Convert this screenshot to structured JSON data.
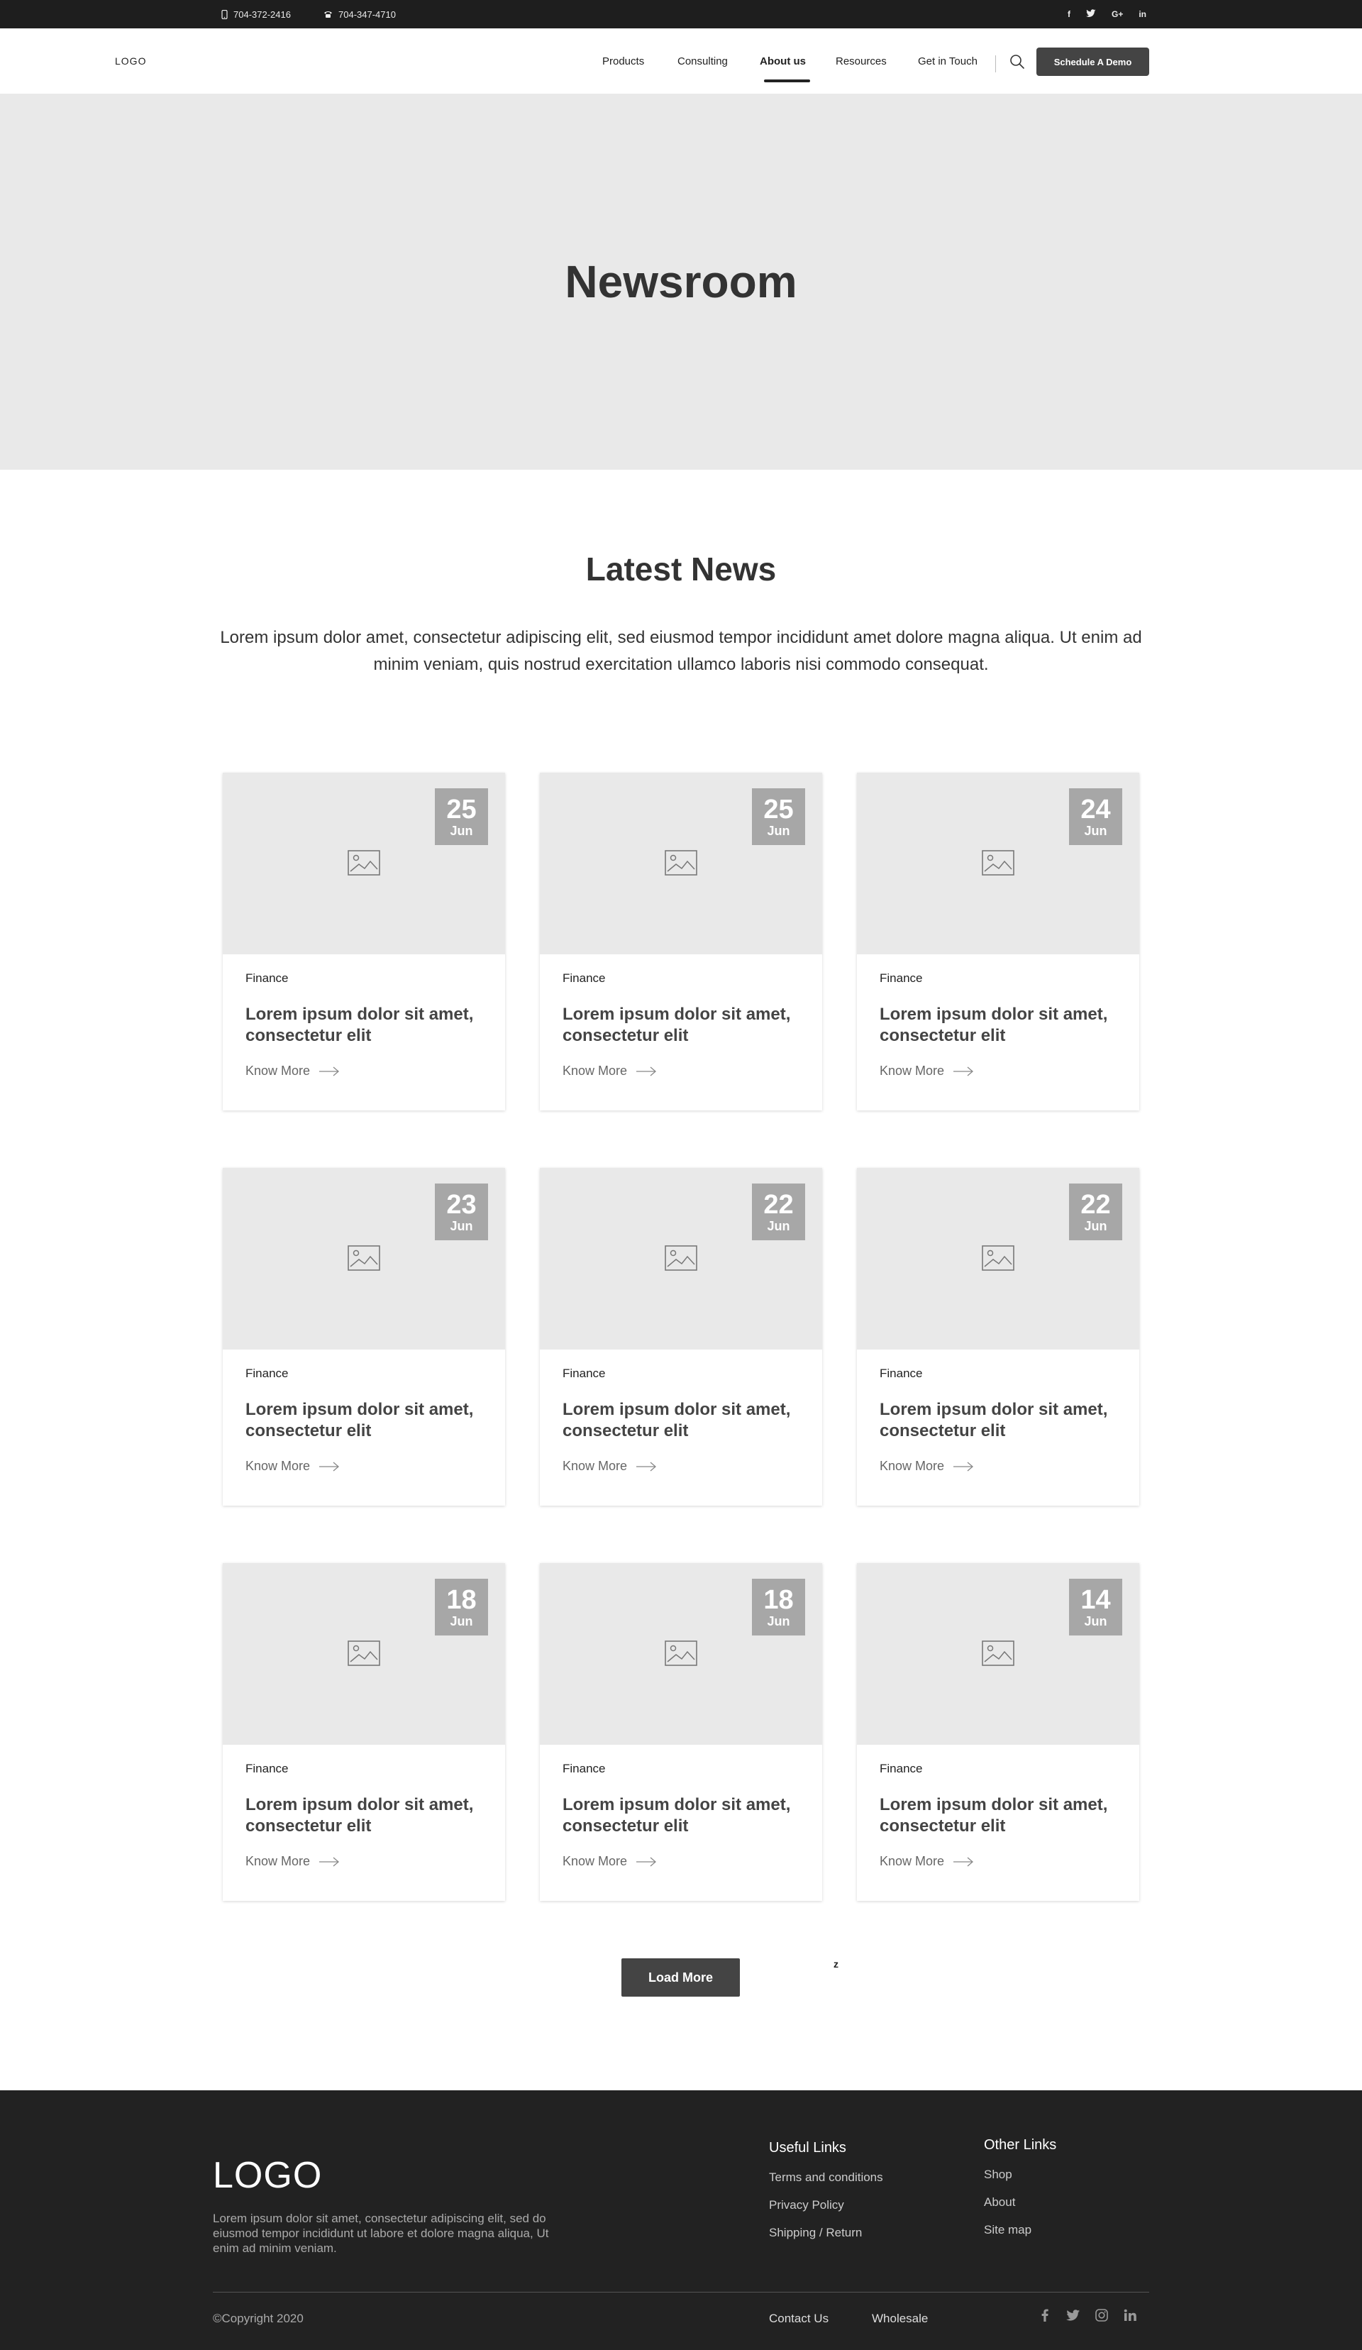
{
  "topbar": {
    "phone1": "704-372-2416",
    "phone2": "704-347-4710",
    "social": [
      "f",
      "t",
      "G+",
      "in"
    ]
  },
  "nav": {
    "logo": "LOGO",
    "items": [
      "Products",
      "Consulting",
      "About us",
      "Resources",
      "Get in Touch"
    ],
    "active": "About us",
    "cta": "Schedule A Demo"
  },
  "hero": {
    "title": "Newsroom"
  },
  "latest": {
    "title": "Latest News",
    "intro": "Lorem ipsum dolor amet, consectetur adipiscing elit, sed eiusmod tempor incididunt amet dolore magna aliqua. Ut enim ad minim veniam, quis nostrud exercitation ullamco laboris nisi commodo consequat."
  },
  "cards": [
    {
      "day": "25",
      "month": "Jun",
      "category": "Finance",
      "title": "Lorem ipsum dolor sit amet, consectetur elit",
      "link": "Know More"
    },
    {
      "day": "25",
      "month": "Jun",
      "category": "Finance",
      "title": "Lorem ipsum dolor sit amet, consectetur elit",
      "link": "Know More"
    },
    {
      "day": "24",
      "month": "Jun",
      "category": "Finance",
      "title": "Lorem ipsum dolor sit amet, consectetur elit",
      "link": "Know More"
    },
    {
      "day": "23",
      "month": "Jun",
      "category": "Finance",
      "title": "Lorem ipsum dolor sit amet, consectetur elit",
      "link": "Know More"
    },
    {
      "day": "22",
      "month": "Jun",
      "category": "Finance",
      "title": "Lorem ipsum dolor sit amet, consectetur elit",
      "link": "Know More"
    },
    {
      "day": "22",
      "month": "Jun",
      "category": "Finance",
      "title": "Lorem ipsum dolor sit amet, consectetur elit",
      "link": "Know More"
    },
    {
      "day": "18",
      "month": "Jun",
      "category": "Finance",
      "title": "Lorem ipsum dolor sit amet, consectetur elit",
      "link": "Know More"
    },
    {
      "day": "18",
      "month": "Jun",
      "category": "Finance",
      "title": "Lorem ipsum dolor sit amet, consectetur elit",
      "link": "Know More"
    },
    {
      "day": "14",
      "month": "Jun",
      "category": "Finance",
      "title": "Lorem ipsum dolor sit amet, consectetur elit",
      "link": "Know More"
    }
  ],
  "load_more": "Load More",
  "stray_text": "z",
  "footer": {
    "logo": "LOGO",
    "description": "Lorem ipsum dolor sit amet, consectetur adipiscing elit, sed do eiusmod tempor incididunt ut labore et dolore magna aliqua, Ut enim ad minim veniam.",
    "useful_title": "Useful Links",
    "useful_links": [
      "Terms and conditions",
      "Privacy Policy",
      "Shipping / Return"
    ],
    "other_title": "Other Links",
    "other_links": [
      "Shop",
      "About",
      "Site map"
    ],
    "copyright": "©Copyright 2020",
    "bottom_links": [
      "Contact Us",
      "Wholesale"
    ],
    "social": [
      "facebook-icon",
      "twitter-icon",
      "instagram-icon",
      "linkedin-icon"
    ]
  }
}
